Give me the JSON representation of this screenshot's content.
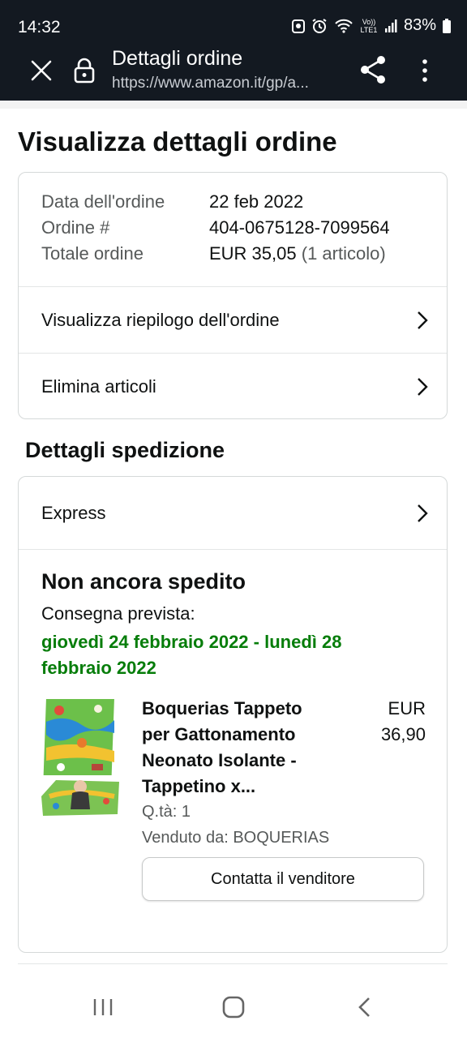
{
  "status_bar": {
    "time": "14:32",
    "signal_label": "Vo)) LTE1",
    "battery": "83%"
  },
  "toolbar": {
    "title": "Dettagli ordine",
    "url": "https://www.amazon.it/gp/a..."
  },
  "page": {
    "title": "Visualizza dettagli ordine"
  },
  "summary": {
    "date_label": "Data dell'ordine",
    "date_value": "22 feb 2022",
    "order_label": "Ordine #",
    "order_value": "404-0675128-7099564",
    "total_label": "Totale ordine",
    "total_value": "EUR 35,05",
    "total_items": "(1 articolo)"
  },
  "actions": {
    "view_summary": "Visualizza riepilogo dell'ordine",
    "delete_items": "Elimina articoli"
  },
  "shipping": {
    "section_title": "Dettagli spedizione",
    "method": "Express",
    "status": "Non ancora spedito",
    "delivery_label": "Consegna prevista:",
    "delivery_dates": "giovedì 24 febbraio 2022 - lunedì 28 febbraio 2022"
  },
  "product": {
    "name": "Boquerias Tappeto per Gattonamento Neonato Isolante - Tappetino x...",
    "price_currency": "EUR",
    "price_value": "36,90",
    "quantity": "Q.tà: 1",
    "seller": "Venduto da: BOQUERIAS",
    "contact_button": "Contatta il venditore"
  },
  "colors": {
    "header_bg": "#131921",
    "delivery_green": "#067d0a",
    "border": "#d5d9d9"
  }
}
